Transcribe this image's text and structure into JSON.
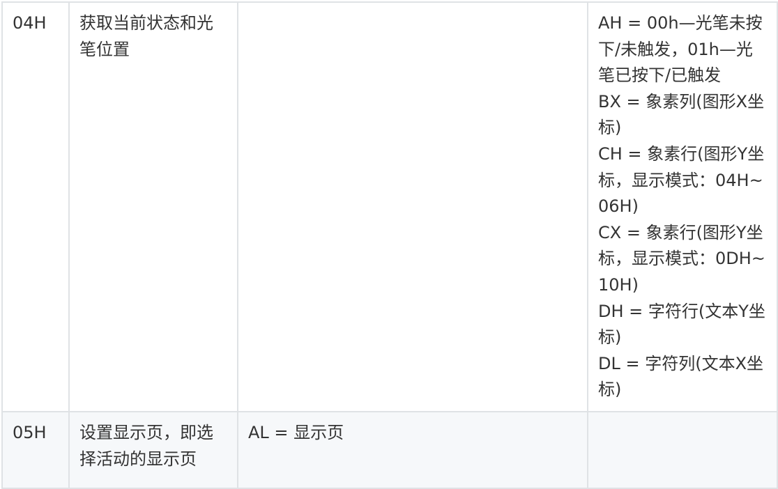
{
  "rows": [
    {
      "code": "04H",
      "function": "获取当前状态和光笔位置",
      "input": "",
      "output": [
        "AH = 00h—光笔未按下/未触发，01h—光笔已按下/已触发",
        "BX = 象素列(图形X坐标)",
        "CH = 象素行(图形Y坐标，显示模式：04H~06H)",
        "CX = 象素行(图形Y坐标，显示模式：0DH~10H)",
        "DH = 字符行(文本Y坐标)",
        "DL = 字符列(文本X坐标)"
      ]
    },
    {
      "code": "05H",
      "function": "设置显示页，即选择活动的显示页",
      "input": "AL = 显示页",
      "output": []
    }
  ]
}
